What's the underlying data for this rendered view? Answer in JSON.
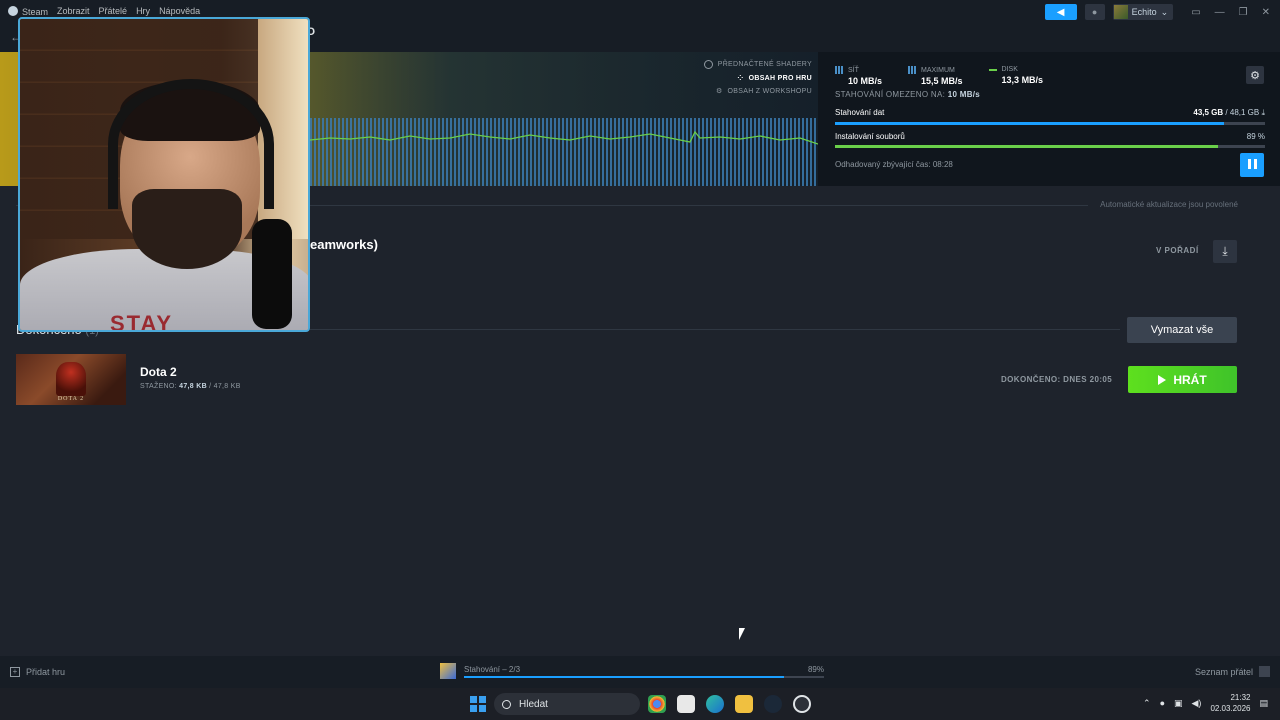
{
  "menu": {
    "items": [
      "Steam",
      "Zobrazit",
      "Přátelé",
      "Hry",
      "Nápověda"
    ]
  },
  "user": {
    "name": "Echito"
  },
  "page_title_fragment": "TO",
  "hero": {
    "content_types": {
      "shaders": "PŘEDNAČTENÉ SHADERY",
      "game_content": "OBSAH PRO HRU",
      "workshop": "OBSAH Z WORKSHOPU"
    },
    "stats": {
      "network_label": "SÍŤ",
      "network_value": "10 MB/s",
      "max_label": "MAXIMUM",
      "max_value": "15,5 MB/s",
      "disk_label": "DISK",
      "disk_value": "13,3 MB/s"
    },
    "throttle_label": "STAHOVÁNÍ OMEZENO NA:",
    "throttle_value": "10 MB/s",
    "download_label": "Stahování dat",
    "download_done": "43,5 GB",
    "download_total": "/ 48,1 GB",
    "download_fraction": 0.904,
    "install_label": "Instalování souborů",
    "install_percent": "89 %",
    "install_fraction": 0.89,
    "eta": "Odhadovaný zbývající čas: 08:28",
    "colors": {
      "accent": "#1a9fff",
      "network": "#4a90c8",
      "disk": "#6ad04a"
    }
  },
  "updates": {
    "auto_text": "Automatické aktualizace jsou povolené"
  },
  "queued": {
    "title_fragment": "eamworks)",
    "status": "V POŘADÍ"
  },
  "completed": {
    "title": "Dokončeno",
    "count": "(1)",
    "clear_label": "Vymazat vše",
    "game": {
      "name": "Dota 2",
      "thumb_logo": "DOTA 2",
      "downloaded_label": "STAŽENO:",
      "downloaded_value": "47,8 KB",
      "downloaded_total": "/ 47,8 KB",
      "done_text": "DOKONČENO: DNES 20:05",
      "play_label": "HRÁT"
    }
  },
  "webcam": {
    "shirt_text": "STAY"
  },
  "statusbar": {
    "add_game": "Přidat hru",
    "download_text": "Stahování – 2/3",
    "download_percent": "89%",
    "download_fraction": 0.89,
    "friends": "Seznam přátel"
  },
  "taskbar": {
    "search_placeholder": "Hledat",
    "time": "21:32",
    "date": "02.03.2026"
  }
}
